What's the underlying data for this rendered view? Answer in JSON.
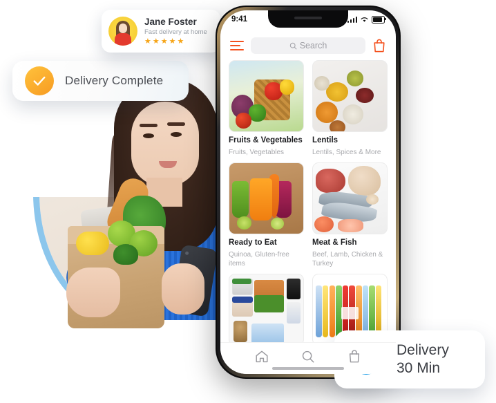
{
  "user_card": {
    "name": "Jane Foster",
    "subtitle": "Fast delivery at home",
    "rating_stars": 5,
    "star_glyph": "★",
    "avatar_name": "jane-foster-avatar"
  },
  "delivery_complete_badge": {
    "label": "Delivery Complete",
    "icon": "check-circle-icon",
    "icon_color": "#F9A825"
  },
  "delivery_time_badge": {
    "title": "Delivery",
    "duration": "30 Min",
    "icon": "alarm-clock-icon",
    "icon_color": "#2196F3",
    "bell_color": "#F4524D"
  },
  "phone": {
    "status_bar": {
      "time": "9:41",
      "icons": [
        "signal-bars-icon",
        "wifi-icon",
        "battery-icon"
      ]
    },
    "app_bar": {
      "menu_icon": "hamburger-menu-icon",
      "search_placeholder": "Search",
      "search_icon": "search-icon",
      "cart_icon": "shopping-bag-icon",
      "accent_color": "#F4511E"
    },
    "categories": [
      {
        "title": "Fruits & Vegetables",
        "subtitle": "Fruits, Vegetables",
        "image": "vegetable-basket-image"
      },
      {
        "title": "Lentils",
        "subtitle": "Lentils, Spices & More",
        "image": "lentil-bowls-image"
      },
      {
        "title": "Ready to Eat",
        "subtitle": "Quinoa, Gluten-free items",
        "image": "smoothie-juices-image"
      },
      {
        "title": "Meat & Fish",
        "subtitle": "Beef, Lamb, Chicken & Turkey",
        "image": "meat-fish-image"
      },
      {
        "title": "",
        "subtitle": "",
        "image": "packaged-food-image"
      },
      {
        "title": "",
        "subtitle": "",
        "image": "beverages-bottles-image"
      }
    ],
    "tab_bar": {
      "tabs": [
        {
          "name": "home",
          "icon": "home-icon"
        },
        {
          "name": "search",
          "icon": "search-icon"
        },
        {
          "name": "bag",
          "icon": "shopping-bag-icon"
        }
      ]
    }
  },
  "hero_photo": {
    "description": "woman-holding-grocery-bag-and-phone",
    "arc_color": "#8CC6EC"
  }
}
